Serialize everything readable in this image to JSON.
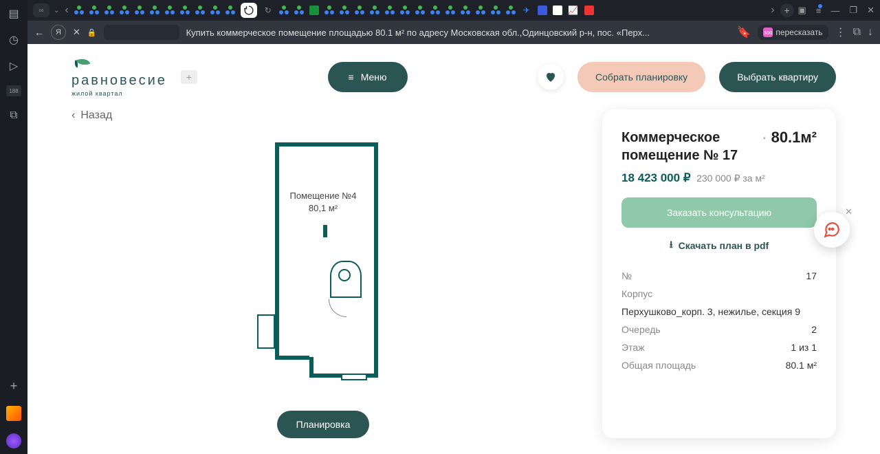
{
  "vbar": {
    "badge": "188"
  },
  "browser": {
    "page_title": "Купить коммерческое помещение площадью 80.1 м² по адресу Московская обл.,Одинцовский р-н, пос. «Перх...",
    "summarize": "пересказать"
  },
  "header": {
    "logo_text": "равновесие",
    "logo_sub": "жилой квартал",
    "phone": "+",
    "menu": "Меню",
    "collect": "Собрать планировку",
    "choose": "Выбрать квартиру"
  },
  "back": "Назад",
  "floorplan": {
    "room_label": "Помещение №4",
    "room_area": "80,1 м²",
    "chip": "Планировка"
  },
  "panel": {
    "title": "Коммерческое помещение № 17",
    "area": "80.1м²",
    "price": "18 423 000 ₽",
    "price_per": "230 000 ₽ за м²",
    "consult": "Заказать консультацию",
    "pdf": "Скачать план в pdf",
    "specs": {
      "num_label": "№",
      "num_val": "17",
      "building_label": "Корпус",
      "building_val": "Перхушково_корп. 3, нежилье, секция 9",
      "queue_label": "Очередь",
      "queue_val": "2",
      "floor_label": "Этаж",
      "floor_val": "1 из 1",
      "total_label": "Общая площадь",
      "total_val": "80.1 м²"
    }
  }
}
